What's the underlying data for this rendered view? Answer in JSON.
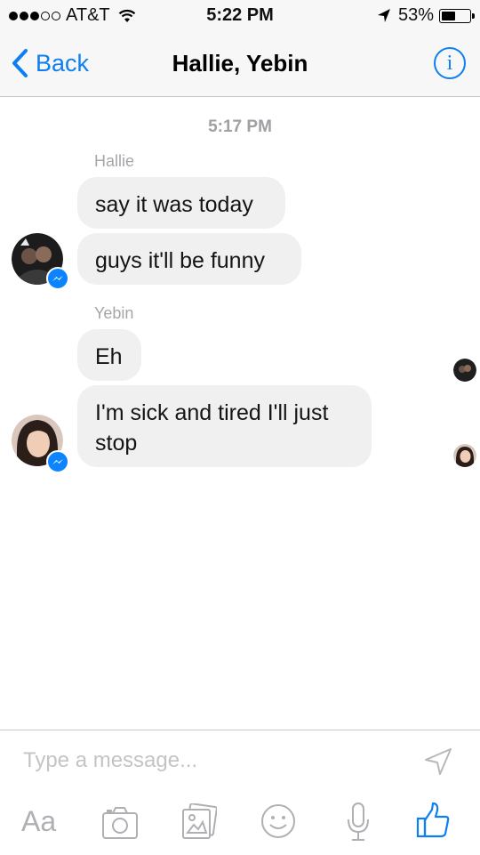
{
  "status": {
    "carrier": "AT&T",
    "time": "5:22 PM",
    "battery": "53%",
    "battery_level": 0.53,
    "signal_bars": 3
  },
  "nav": {
    "back_label": "Back",
    "title": "Hallie, Yebin",
    "info_glyph": "i"
  },
  "conversation": {
    "timestamp": "5:17 PM",
    "groups": [
      {
        "sender": "Hallie",
        "messages": [
          "say it was today",
          "guys it'll be funny"
        ]
      },
      {
        "sender": "Yebin",
        "messages": [
          "Eh",
          "I'm sick and tired I'll just stop"
        ]
      }
    ]
  },
  "composer": {
    "placeholder": "Type a message...",
    "aa_label": "Aa",
    "icons": [
      "send-icon",
      "text-format-icon",
      "camera-icon",
      "gallery-icon",
      "emoji-icon",
      "microphone-icon",
      "thumbs-up-icon"
    ]
  },
  "colors": {
    "accent": "#0d7ff2",
    "bubble": "#f0f0f0",
    "muted": "#a0a0a4"
  }
}
